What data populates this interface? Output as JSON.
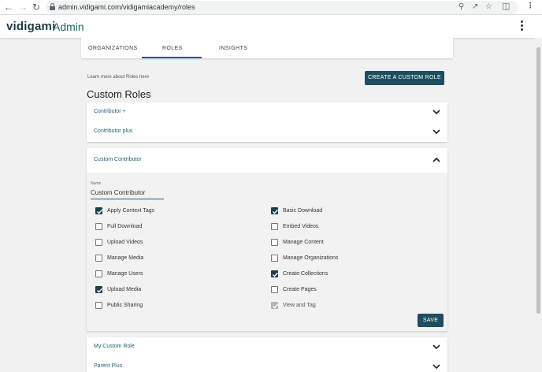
{
  "browser": {
    "url": "admin.vidigami.com/vidigamiacademy/roles"
  },
  "header": {
    "logo": "vidigami",
    "app_name": "Admin"
  },
  "tabs": [
    {
      "label": "ORGANIZATIONS",
      "active": false
    },
    {
      "label": "ROLES",
      "active": true
    },
    {
      "label": "INSIGHTS",
      "active": false
    }
  ],
  "roles_page": {
    "learn_more": "Learn more about Roles here",
    "create_button": "CREATE A CUSTOM ROLE",
    "title": "Custom Roles"
  },
  "roles": [
    {
      "name": "Contributor +",
      "expanded": false
    },
    {
      "name": "Contributor plus",
      "expanded": false
    },
    {
      "name": "Custom Contributor",
      "expanded": true
    },
    {
      "name": "My Custom Role",
      "expanded": false
    },
    {
      "name": "Parent Plus",
      "expanded": false
    }
  ],
  "editor": {
    "name_label": "Name",
    "name_value": "Custom Contributor",
    "save_label": "SAVE",
    "permissions_left": [
      {
        "label": "Apply Context Tags",
        "checked": true,
        "disabled": false
      },
      {
        "label": "Full Download",
        "checked": false,
        "disabled": false
      },
      {
        "label": "Upload Videos",
        "checked": false,
        "disabled": false
      },
      {
        "label": "Manage Media",
        "checked": false,
        "disabled": false
      },
      {
        "label": "Manage Users",
        "checked": false,
        "disabled": false
      },
      {
        "label": "Upload Media",
        "checked": true,
        "disabled": false
      },
      {
        "label": "Public Sharing",
        "checked": false,
        "disabled": false
      }
    ],
    "permissions_right": [
      {
        "label": "Basic Download",
        "checked": true,
        "disabled": false
      },
      {
        "label": "Embed Videos",
        "checked": false,
        "disabled": false
      },
      {
        "label": "Manage Content",
        "checked": false,
        "disabled": false
      },
      {
        "label": "Manage Organizations",
        "checked": false,
        "disabled": false
      },
      {
        "label": "Create Collections",
        "checked": true,
        "disabled": false
      },
      {
        "label": "Create Pages",
        "checked": false,
        "disabled": false
      },
      {
        "label": "View and Tag",
        "checked": true,
        "disabled": true
      }
    ]
  },
  "colors": {
    "primary": "#1d4e5f",
    "accent": "#1f5f73",
    "checkbox_checked": "#1d3f4f"
  }
}
